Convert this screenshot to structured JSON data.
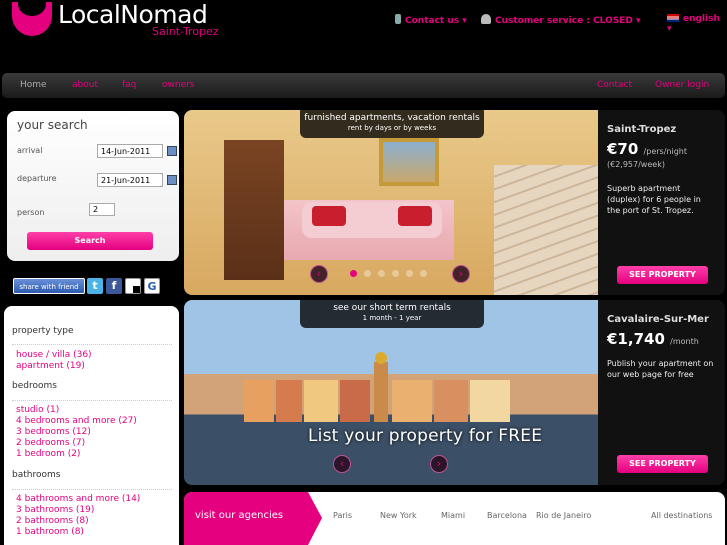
{
  "brand": {
    "name": "LocalNomad",
    "sub": "Saint-Tropez"
  },
  "topbar": {
    "contact": "Contact us ▾",
    "service": "Customer service : CLOSED ▾",
    "language": "english ▾"
  },
  "nav": {
    "home": "Home",
    "about": "about",
    "faq": "faq",
    "owners": "owners",
    "contact": "Contact",
    "owner_login": "Owner login"
  },
  "search": {
    "title": "your search",
    "arrival_label": "arrival",
    "arrival_value": "14-Jun-2011",
    "departure_label": "departure",
    "departure_value": "21-Jun-2011",
    "person_label": "person",
    "person_value": "2",
    "button": "Search"
  },
  "share": {
    "label": "share with friend",
    "icons": [
      "twitter-icon",
      "facebook-icon",
      "delicious-icon",
      "google-icon"
    ]
  },
  "filters": {
    "property_type": "property type",
    "property_items": [
      "house / villa (36)",
      "apartment (19)"
    ],
    "bedrooms": "bedrooms",
    "bedroom_items": [
      "studio (1)",
      "4 bedrooms and more (27)",
      "3 bedrooms (12)",
      "2 bedrooms (7)",
      "1 bedroom (2)"
    ],
    "bathrooms": "bathrooms",
    "bathroom_items": [
      "4 bathrooms and more (14)",
      "3 bathrooms (19)",
      "2 bathrooms (8)",
      "1 bathroom (8)"
    ]
  },
  "slide1": {
    "banner_line1": "furnished apartments, vacation rentals",
    "banner_line2": "rent by days or by weeks",
    "location": "Saint-Tropez",
    "price": "€70",
    "price_unit": "/pers/night",
    "week": "(€2,957/week)",
    "description": "Superb apartment (duplex) for 6 people in the port of St. Tropez.",
    "button": "SEE PROPERTY"
  },
  "slide2": {
    "banner_line1": "see our short term rentals",
    "banner_line2": "1 month - 1 year",
    "promo": "List your property for FREE",
    "location": "Cavalaire-Sur-Mer",
    "price": "€1,740",
    "price_unit": "/month",
    "description": "Publish your apartment on our web page for free",
    "button": "SEE PROPERTY"
  },
  "agencies": {
    "title": "visit our agencies",
    "cities": [
      "Paris",
      "New York",
      "Miami",
      "Barcelona",
      "Rio de Janeiro"
    ],
    "all": "All destinations"
  },
  "colors": {
    "accent": "#e4007f",
    "background": "#000000"
  }
}
